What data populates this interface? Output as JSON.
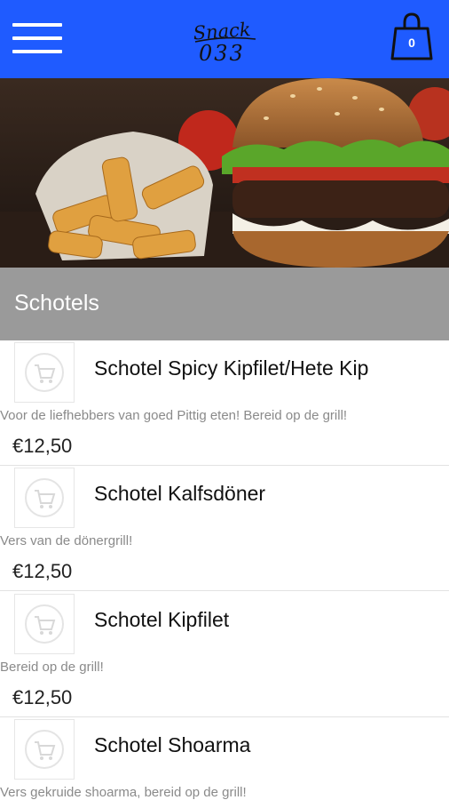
{
  "header": {
    "menu_icon": "hamburger-icon",
    "logo_line1": "Snack",
    "logo_line2": "033",
    "cart_icon": "shopping-bag-icon",
    "cart_count": "0",
    "color": "#1f5bff"
  },
  "hero": {
    "alt": "burger-and-fries-photo"
  },
  "section": {
    "title": "Schotels",
    "color": "#9a9a9a"
  },
  "items": [
    {
      "name": "Schotel Spicy Kipfilet/Hete Kip",
      "description": "Voor de liefhebbers van goed Pittig eten! Bereid op de grill!",
      "price": "€12,50",
      "icon": "cart-placeholder-icon"
    },
    {
      "name": "Schotel Kalfsdöner",
      "description": "Vers van de dönergrill!",
      "price": "€12,50",
      "icon": "cart-placeholder-icon"
    },
    {
      "name": "Schotel Kipfilet",
      "description": "Bereid op de grill!",
      "price": "€12,50",
      "icon": "cart-placeholder-icon"
    },
    {
      "name": "Schotel Shoarma",
      "description": "Vers gekruide shoarma, bereid op de grill!",
      "price": "",
      "icon": "cart-placeholder-icon"
    }
  ]
}
